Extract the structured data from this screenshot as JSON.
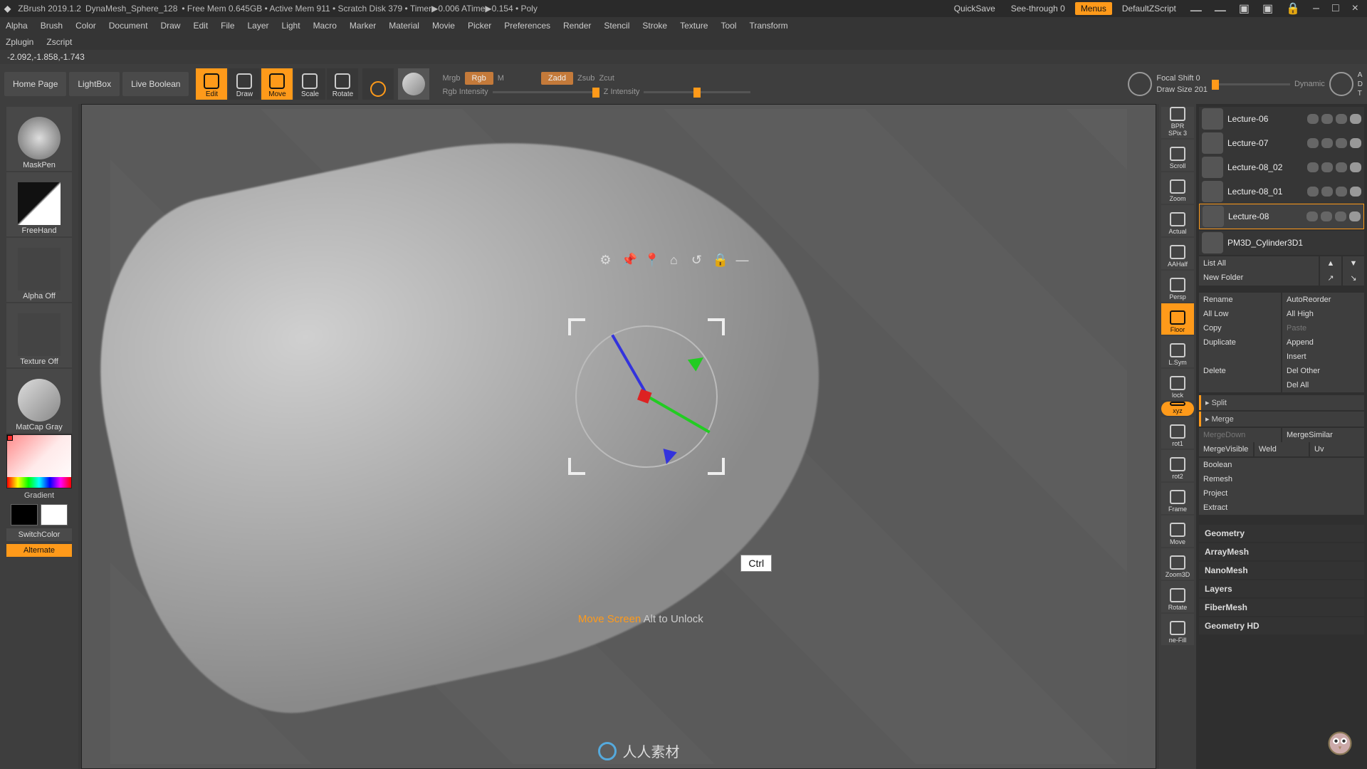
{
  "title": {
    "app": "ZBrush 2019.1.2",
    "doc": "DynaMesh_Sphere_128",
    "mem": "• Free Mem 0.645GB • Active Mem 911 • Scratch Disk 379 • Timer▶0.006 ATime▶0.154 • Poly",
    "quicksave": "QuickSave",
    "see_through": "See-through  0",
    "menus": "Menus",
    "zscript": "DefaultZScript"
  },
  "window_controls": [
    "–",
    "□",
    "×"
  ],
  "menubar": [
    "Alpha",
    "Brush",
    "Color",
    "Document",
    "Draw",
    "Edit",
    "File",
    "Layer",
    "Light",
    "Macro",
    "Marker",
    "Material",
    "Movie",
    "Picker",
    "Preferences",
    "Render",
    "Stencil",
    "Stroke",
    "Texture",
    "Tool",
    "Transform"
  ],
  "menubar2": [
    "Zplugin",
    "Zscript"
  ],
  "status": "-2.092,-1.858,-1.743",
  "shelf_text_buttons": [
    "Home Page",
    "LightBox",
    "Live Boolean"
  ],
  "shelf_icons": [
    {
      "label": "Edit",
      "active": true
    },
    {
      "label": "Draw",
      "active": false
    },
    {
      "label": "Move",
      "active": true
    },
    {
      "label": "Scale",
      "active": false
    },
    {
      "label": "Rotate",
      "active": false
    }
  ],
  "shelf_mid": {
    "mrgb": "Mrgb",
    "rgb": "Rgb",
    "m": "M",
    "zadd": "Zadd",
    "zsub": "Zsub",
    "zcut": "Zcut",
    "rgb_intensity": "Rgb Intensity",
    "z_intensity": "Z Intensity"
  },
  "focal": {
    "focal": "Focal Shift  0",
    "draw": "Draw Size  201",
    "dynamic": "Dynamic",
    "a": "A",
    "d": "D",
    "t": "T"
  },
  "left_tiles": {
    "maskpen": "MaskPen",
    "freehand": "FreeHand",
    "alphaoff": "Alpha Off",
    "textureoff": "Texture Off",
    "matcap": "MatCap Gray",
    "gradient": "Gradient",
    "switch": "SwitchColor",
    "alternate": "Alternate"
  },
  "overlay_icons": [
    "gear",
    "pin",
    "marker",
    "home",
    "undo",
    "lock",
    "minus"
  ],
  "key_hint": "Ctrl",
  "move_hint_ornge": "Move Screen",
  "move_hint_rest": " Alt to Unlock",
  "footer": "人人素材",
  "right_tools": [
    {
      "label": "BPR",
      "sub": "SPix 3"
    },
    {
      "label": "Scroll"
    },
    {
      "label": "Zoom"
    },
    {
      "label": "Actual"
    },
    {
      "label": "AAHalf"
    },
    {
      "label": "Persp"
    },
    {
      "label": "Floor",
      "active": true
    },
    {
      "label": "L.Sym"
    },
    {
      "label": "lock"
    },
    {
      "label": "xyz",
      "active": true,
      "pill": true
    },
    {
      "label": "rot1"
    },
    {
      "label": "rot2"
    },
    {
      "label": "Frame"
    },
    {
      "label": "Move"
    },
    {
      "label": "Zoom3D"
    },
    {
      "label": "Rotate"
    },
    {
      "label": "ne-Fill"
    }
  ],
  "subtools": [
    {
      "name": "Lecture-06"
    },
    {
      "name": "Lecture-07"
    },
    {
      "name": "Lecture-08_02"
    },
    {
      "name": "Lecture-08_01"
    },
    {
      "name": "Lecture-08",
      "selected": true
    }
  ],
  "subtool_extra": "PM3D_Cylinder3D1",
  "panel_rows": [
    [
      {
        "t": "List All"
      },
      {
        "t": "▲",
        "sq": true
      },
      {
        "t": "▼",
        "sq": true
      }
    ],
    [
      {
        "t": "New Folder"
      },
      {
        "t": "↗",
        "sq": true
      },
      {
        "t": "↘",
        "sq": true
      }
    ]
  ],
  "panel_grid": [
    [
      {
        "t": "Rename"
      },
      {
        "t": "AutoReorder"
      }
    ],
    [
      {
        "t": "All Low"
      },
      {
        "t": "All High"
      }
    ],
    [
      {
        "t": "Copy"
      },
      {
        "t": "Paste",
        "dim": true
      }
    ],
    [
      {
        "t": "Duplicate"
      },
      {
        "t": "Append"
      }
    ],
    [
      {
        "t": ""
      },
      {
        "t": "Insert"
      }
    ],
    [
      {
        "t": "Delete"
      },
      {
        "t": "Del Other"
      }
    ],
    [
      {
        "t": ""
      },
      {
        "t": "Del All"
      }
    ]
  ],
  "accent_items": [
    "Split",
    "Merge"
  ],
  "merge_rows": [
    [
      {
        "t": "MergeDown",
        "dim": true
      },
      {
        "t": "MergeSimilar"
      }
    ],
    [
      {
        "t": "MergeVisible"
      },
      {
        "t": "Weld"
      },
      {
        "t": "Uv"
      }
    ]
  ],
  "more_items": [
    "Boolean",
    "Remesh",
    "Project",
    "Extract"
  ],
  "sections": [
    "Geometry",
    "ArrayMesh",
    "NanoMesh",
    "Layers",
    "FiberMesh",
    "Geometry HD"
  ]
}
